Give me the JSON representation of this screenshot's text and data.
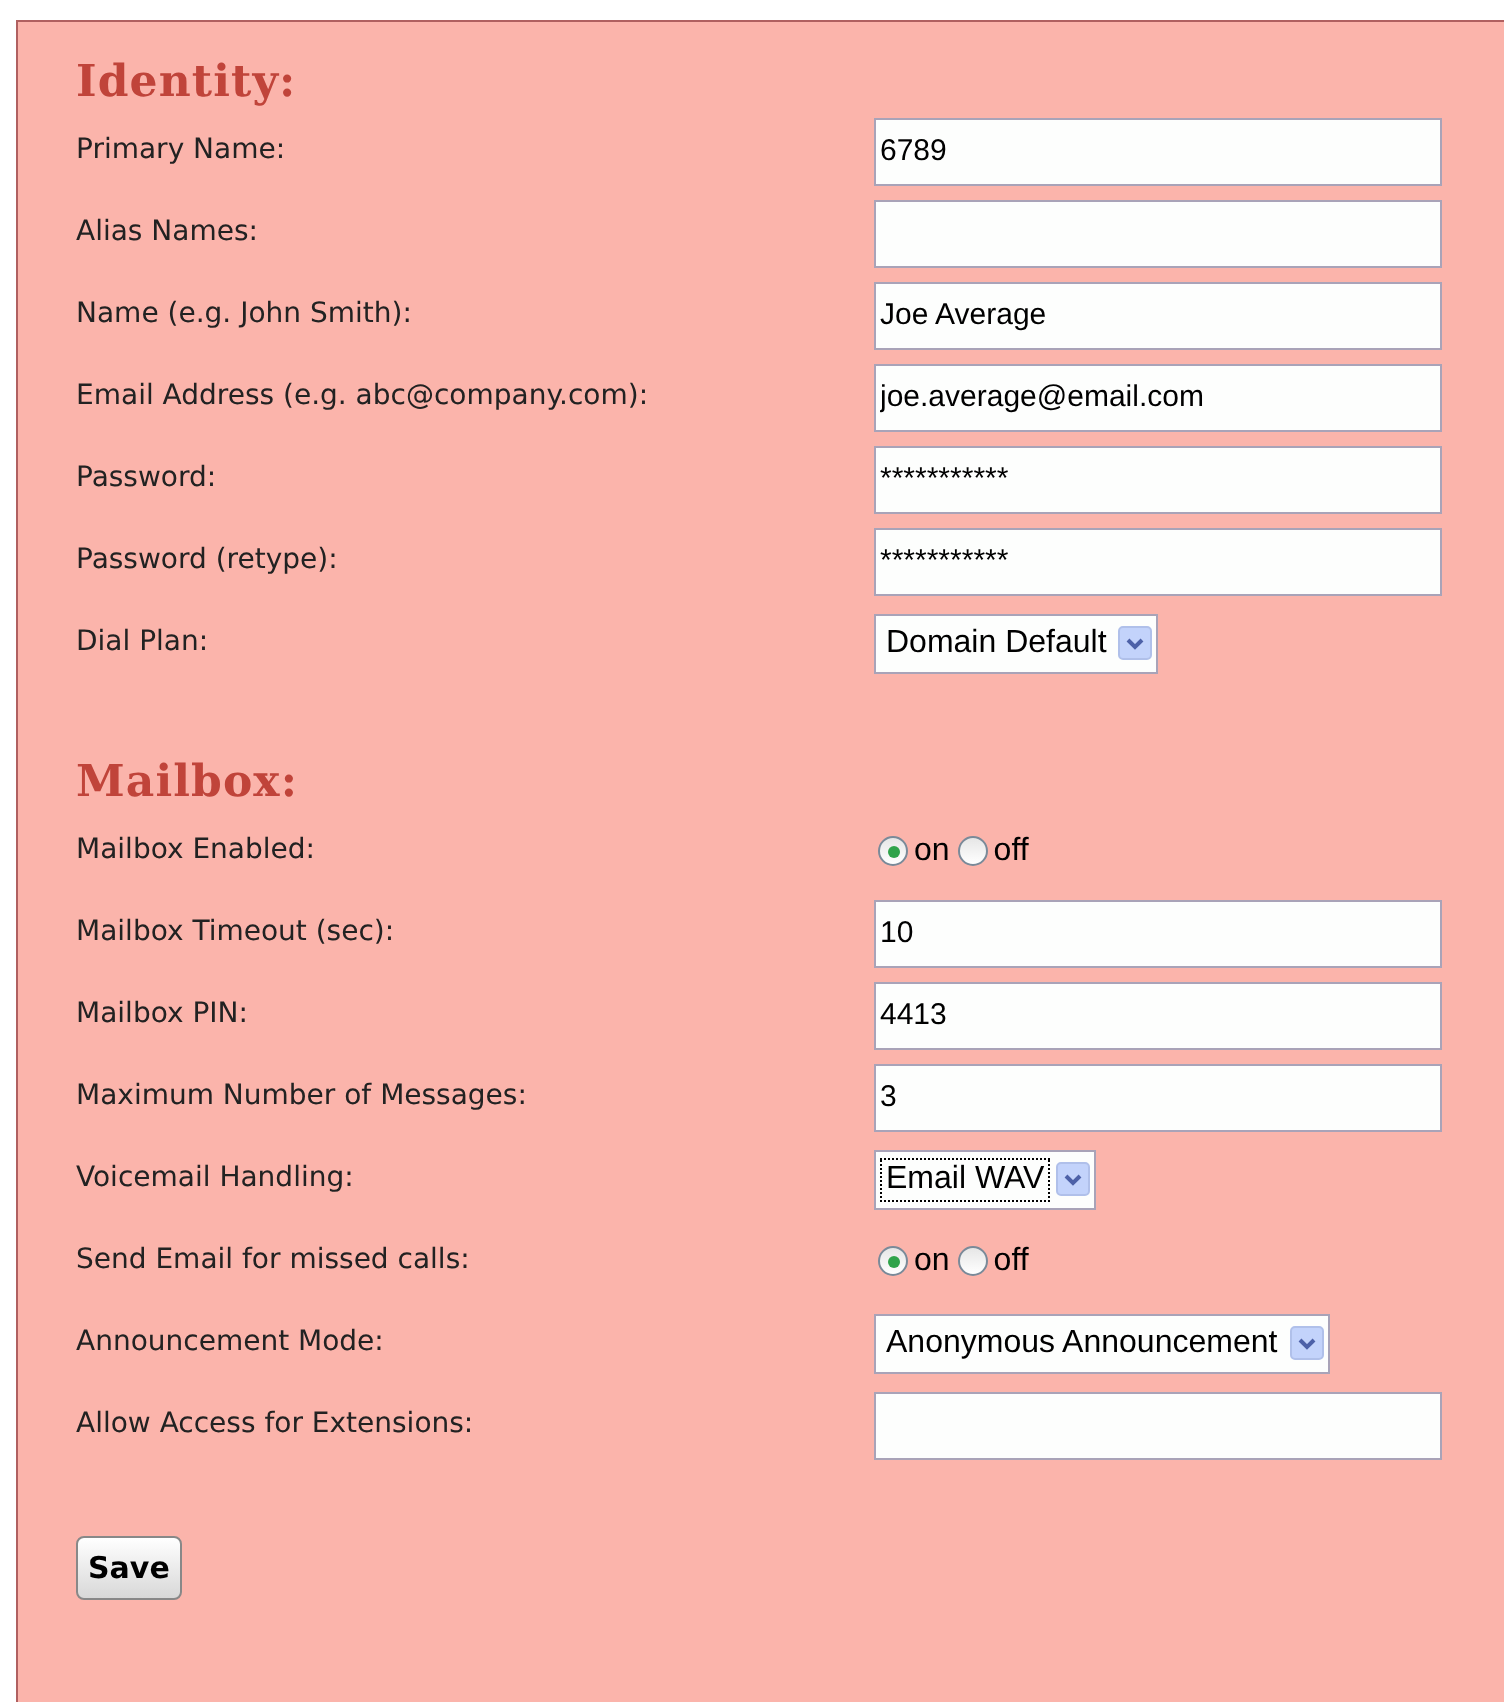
{
  "sections": [
    {
      "title": "Identity:",
      "fields": [
        {
          "kind": "text",
          "label": "Primary Name:",
          "value": "6789"
        },
        {
          "kind": "text",
          "label": "Alias Names:"
        },
        {
          "kind": "text",
          "label": "Name (e.g. John Smith):",
          "value": "Joe Average"
        },
        {
          "kind": "text",
          "label": "Email Address (e.g. abc@company.com):",
          "value": "joe.average@email.com"
        },
        {
          "kind": "text",
          "label": "Password:",
          "value": "***********"
        },
        {
          "kind": "text",
          "label": "Password (retype):",
          "value": "***********"
        },
        {
          "kind": "select",
          "label": "Dial Plan:",
          "value": "Domain Default"
        }
      ]
    },
    {
      "title": "Mailbox:",
      "fields": [
        {
          "kind": "radio",
          "label": "Mailbox Enabled:",
          "options": [
            {
              "label": "on",
              "selected": true
            },
            {
              "label": "off",
              "selected": false
            }
          ]
        },
        {
          "kind": "text",
          "label": "Mailbox Timeout (sec):",
          "value": "10"
        },
        {
          "kind": "text",
          "label": "Mailbox PIN:",
          "value": "4413"
        },
        {
          "kind": "text",
          "label": "Maximum Number of Messages:",
          "value": "3"
        },
        {
          "kind": "select",
          "label": "Voicemail Handling:",
          "value": "Email WAV",
          "focused": true
        },
        {
          "kind": "radio",
          "label": "Send Email for missed calls:",
          "options": [
            {
              "label": "on",
              "selected": true
            },
            {
              "label": "off",
              "selected": false
            }
          ]
        },
        {
          "kind": "select",
          "label": "Announcement Mode:",
          "value": "Anonymous Announcement"
        },
        {
          "kind": "text",
          "label": "Allow Access for Extensions:"
        }
      ]
    }
  ],
  "save_button": "Save"
}
